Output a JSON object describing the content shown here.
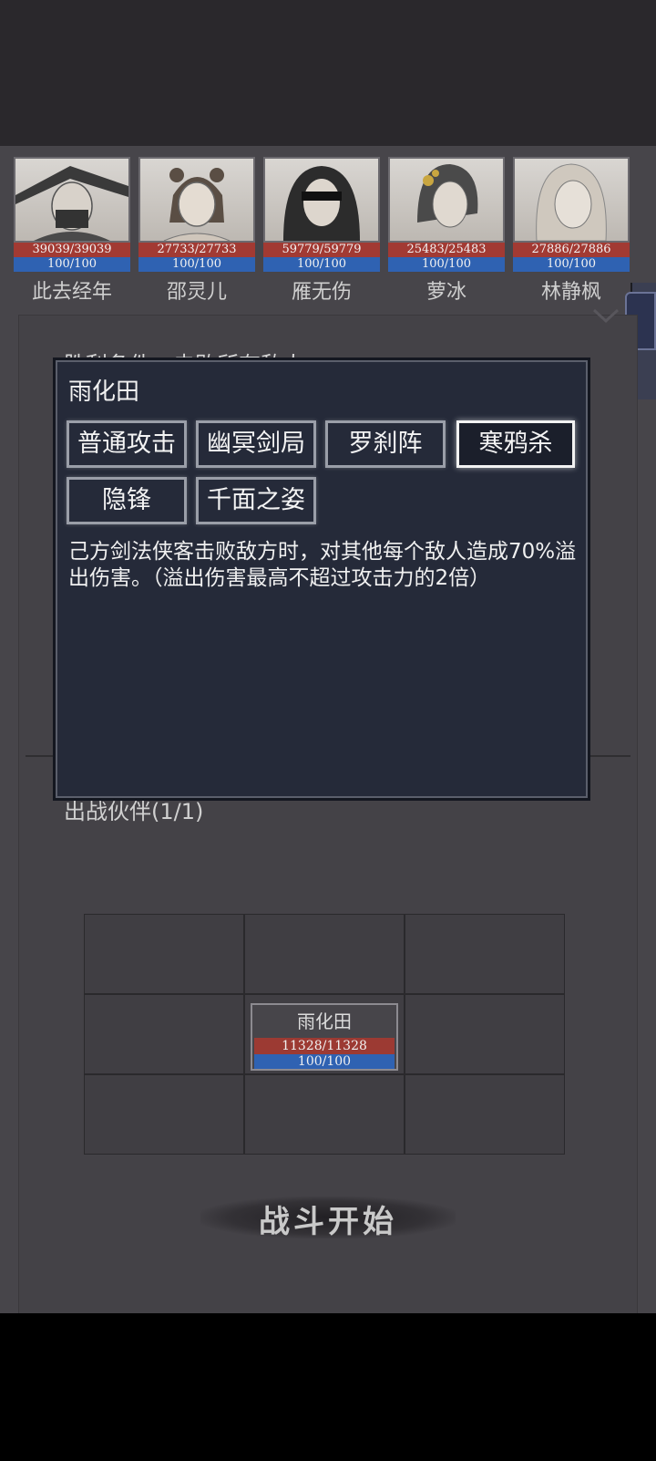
{
  "heroes": [
    {
      "name": "此去经年",
      "hp": "39039/39039",
      "mp": "100/100"
    },
    {
      "name": "邵灵儿",
      "hp": "27733/27733",
      "mp": "100/100"
    },
    {
      "name": "雁无伤",
      "hp": "59779/59779",
      "mp": "100/100"
    },
    {
      "name": "萝冰",
      "hp": "25483/25483",
      "mp": "100/100"
    },
    {
      "name": "林静枫",
      "hp": "27886/27886",
      "mp": "100/100"
    }
  ],
  "battle": {
    "condition": "胜利条件：击败所有敌人",
    "partners_title": "出战伙伴(1/1)",
    "start_label": "战斗开始"
  },
  "unit": {
    "name": "雨化田",
    "hp": "11328/11328",
    "mp": "100/100"
  },
  "popup": {
    "title": "雨化田",
    "skills": [
      "普通攻击",
      "幽冥剑局",
      "罗刹阵",
      "寒鸦杀",
      "隐锋",
      "千面之姿"
    ],
    "selected_skill": "寒鸦杀",
    "description": "己方剑法侠客击败敌方时，对其他每个敌人造成70%溢出伤害。（溢出伤害最高不超过攻击力的2倍）"
  },
  "colors": {
    "hp": "#a23a33",
    "mp": "#2f62b2",
    "popup_bg": "#252a39"
  }
}
